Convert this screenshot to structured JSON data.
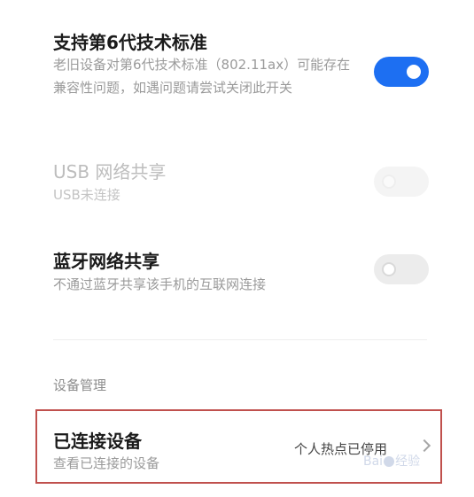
{
  "settings": {
    "wifi6": {
      "title": "支持第6代技术标准",
      "subtitle": "老旧设备对第6代技术标准（802.11ax）可能存在兼容性问题，如遇问题请尝试关闭此开关",
      "enabled": true
    },
    "usb_tethering": {
      "title": "USB 网络共享",
      "subtitle": "USB未连接",
      "enabled": false,
      "disabled": true
    },
    "bluetooth_tethering": {
      "title": "蓝牙网络共享",
      "subtitle": "不通过蓝牙共享该手机的互联网连接",
      "enabled": false
    }
  },
  "device_management": {
    "header": "设备管理",
    "connected_devices": {
      "title": "已连接设备",
      "subtitle": "查看已连接的设备",
      "value": "个人热点已停用"
    }
  },
  "watermark": {
    "text_left": "Bai",
    "text_right": "经验"
  },
  "colors": {
    "accent": "#1d6ff2",
    "highlight_border": "#c0504d"
  }
}
